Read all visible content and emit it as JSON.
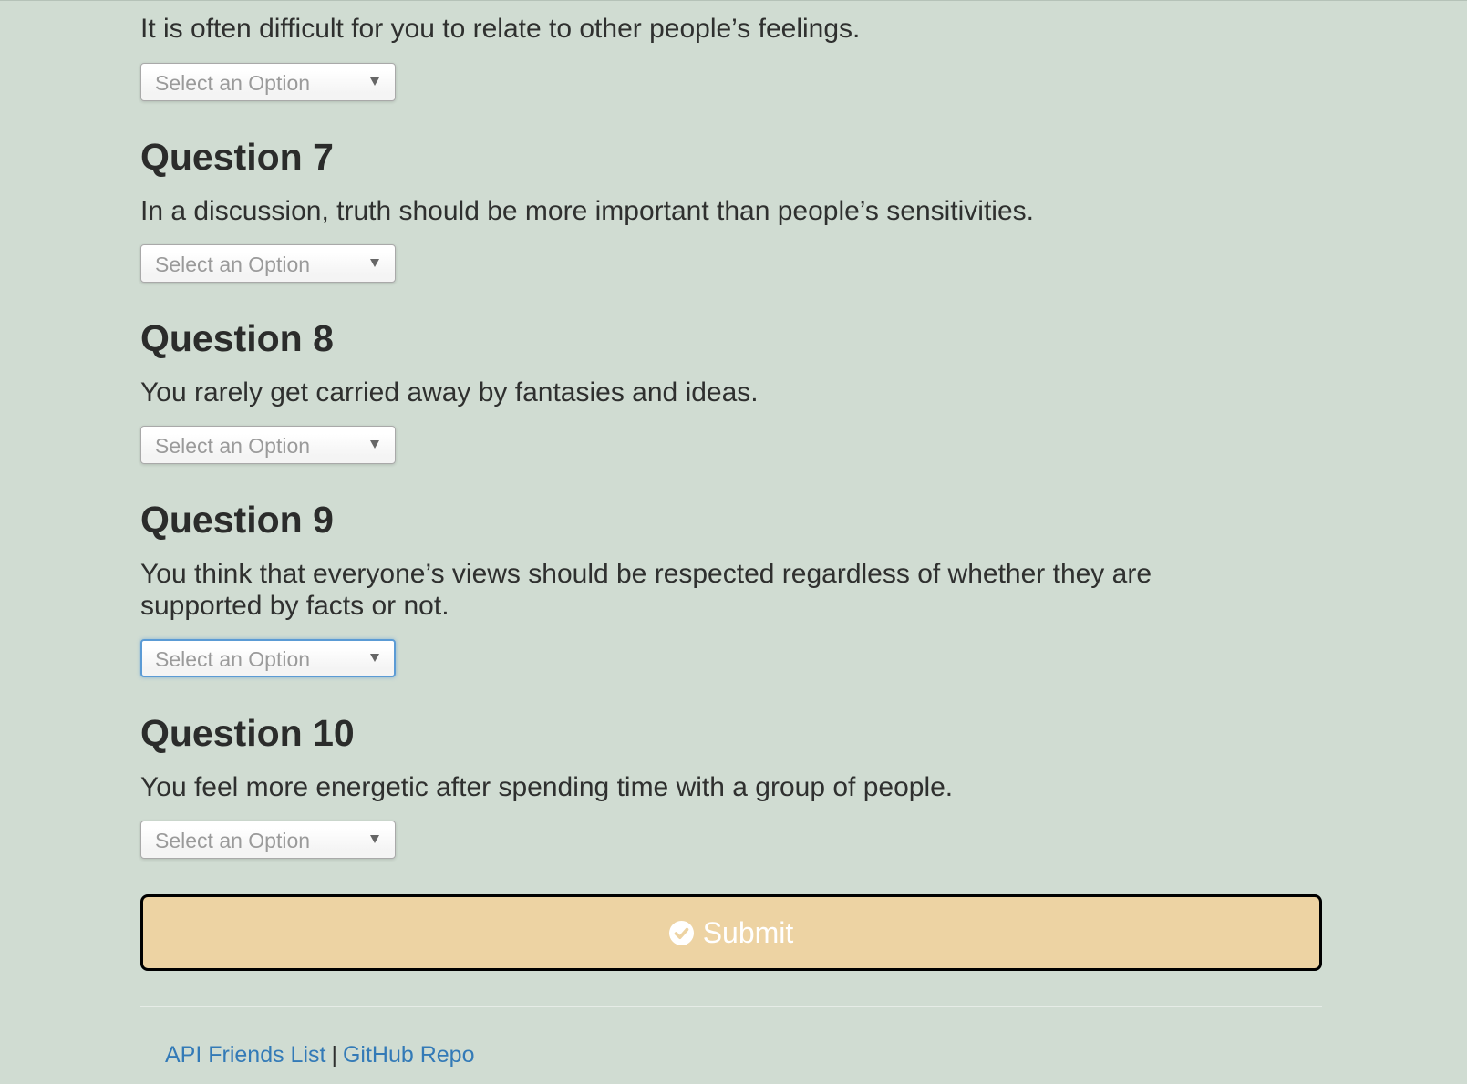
{
  "questions": [
    {
      "prompt": "It is often difficult for you to relate to other people’s feelings.",
      "select_placeholder": "Select an Option"
    },
    {
      "heading": "Question 7",
      "prompt": "In a discussion, truth should be more important than people’s sensitivities.",
      "select_placeholder": "Select an Option"
    },
    {
      "heading": "Question 8",
      "prompt": "You rarely get carried away by fantasies and ideas.",
      "select_placeholder": "Select an Option"
    },
    {
      "heading": "Question 9",
      "prompt": "You think that everyone’s views should be respected regardless of whether they are supported by facts or not.",
      "select_placeholder": "Select an Option"
    },
    {
      "heading": "Question 10",
      "prompt": "You feel more energetic after spending time with a group of people.",
      "select_placeholder": "Select an Option"
    }
  ],
  "submit": {
    "label": "Submit",
    "icon": "check-circle-icon"
  },
  "footer": {
    "link1": "API Friends List",
    "separator": "|",
    "link2": "GitHub Repo"
  },
  "colors": {
    "background": "#d0dcd2",
    "submit_bg": "#edd3a3",
    "link": "#337ab7",
    "focus_border": "#5b9bd5"
  }
}
